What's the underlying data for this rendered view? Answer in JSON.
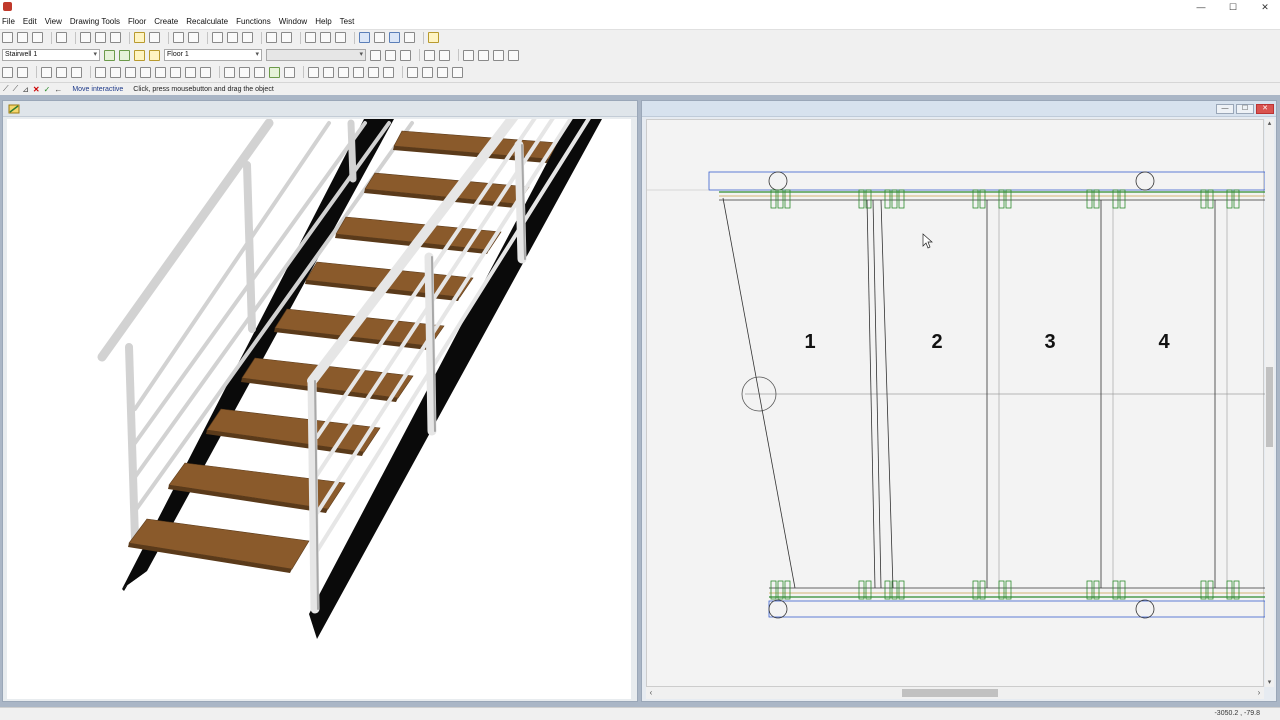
{
  "window": {
    "controls": {
      "minimize": "—",
      "maximize": "☐",
      "close": "✕"
    }
  },
  "menu": {
    "items": [
      "File",
      "Edit",
      "View",
      "Drawing Tools",
      "Floor",
      "Create",
      "Recalculate",
      "Functions",
      "Window",
      "Help",
      "Test"
    ]
  },
  "toolbar": {
    "stairwell_select": "Stairwell 1",
    "floor_select": "Floor 1"
  },
  "status": {
    "mode": "Move interactive",
    "hint": "Click, press mousebutton and drag the object"
  },
  "plan": {
    "step_numbers": [
      "1",
      "2",
      "3",
      "4"
    ]
  },
  "coords": "-3050.2 ,  -79.8",
  "colors": {
    "tread": "#8a5a2b",
    "stringer": "#0a0a0a",
    "railing": "#e6e6e6",
    "plan_green": "#2e8b2e",
    "plan_blue": "#3a5fcd"
  }
}
